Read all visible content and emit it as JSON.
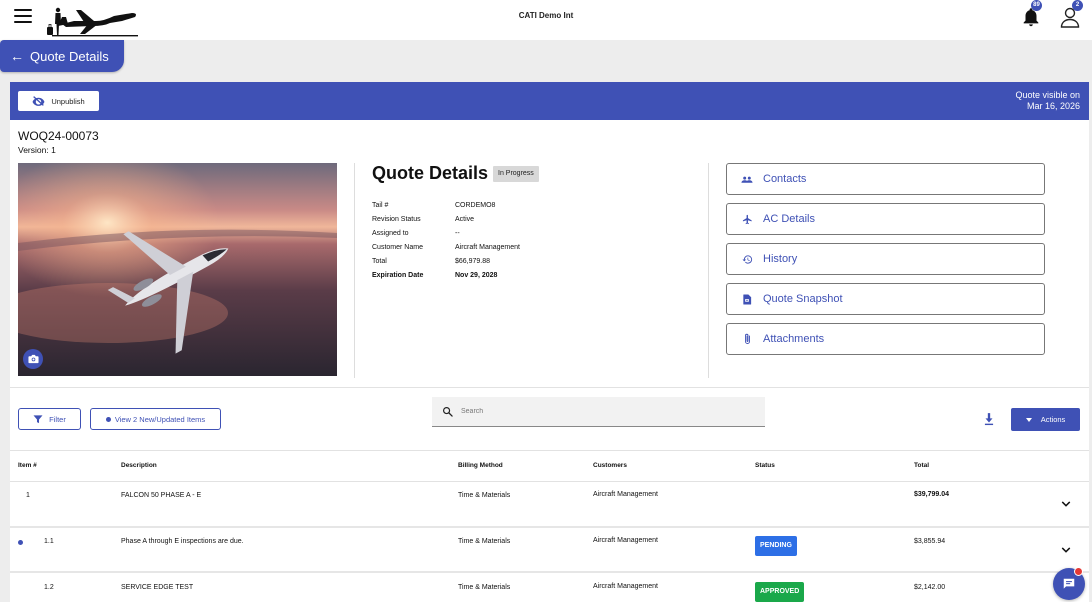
{
  "app": {
    "title": "CATI Demo Int"
  },
  "header": {
    "notifications_count": "89",
    "user_badge": "2"
  },
  "page_tab": {
    "label": "Quote Details"
  },
  "banner": {
    "unpublish_label": "Unpublish",
    "visible_line1": "Quote visible on",
    "visible_line2": "Mar 16, 2026"
  },
  "quote": {
    "number": "WOQ24-00073",
    "version": "Version: 1",
    "title": "Quote Details",
    "status": "In Progress",
    "fields": [
      {
        "key": "Tail #",
        "value": "CORDEMO8"
      },
      {
        "key": "Revision Status",
        "value": "Active"
      },
      {
        "key": "Assigned to",
        "value": "--"
      },
      {
        "key": "Customer Name",
        "value": "Aircraft Management"
      },
      {
        "key": "Total",
        "value": "$66,979.88"
      },
      {
        "key": "Expiration Date",
        "value": "Nov 29, 2028"
      }
    ]
  },
  "side_buttons": [
    {
      "label": "Contacts",
      "icon": "people-icon"
    },
    {
      "label": "AC Details",
      "icon": "airplane-icon"
    },
    {
      "label": "History",
      "icon": "history-icon"
    },
    {
      "label": "Quote Snapshot",
      "icon": "snapshot-icon"
    },
    {
      "label": "Attachments",
      "icon": "paperclip-icon"
    }
  ],
  "toolbar": {
    "filter_label": "Filter",
    "view_updated_label": "View 2 New/Updated Items",
    "search_placeholder": "Search",
    "actions_label": "Actions"
  },
  "table": {
    "headers": [
      "Item #",
      "Description",
      "Billing Method",
      "Customers",
      "Status",
      "Total"
    ],
    "rows": [
      {
        "item": "1",
        "description": "FALCON 50 PHASE A - E",
        "billing": "Time & Materials",
        "customer": "Aircraft Management",
        "status": "",
        "total": "$39,799.04",
        "updated": false
      },
      {
        "item": "1.1",
        "description": "Phase A through E inspections are due.",
        "billing": "Time & Materials",
        "customer": "Aircraft Management",
        "status": "PENDING",
        "total": "$3,855.94",
        "updated": true
      },
      {
        "item": "1.2",
        "description": "SERVICE EDGE TEST",
        "billing": "Time & Materials",
        "customer": "Aircraft Management",
        "status": "APPROVED",
        "total": "$2,142.00",
        "updated": false
      }
    ]
  },
  "colors": {
    "primary": "#3f51b5",
    "pending": "#2d6fe6",
    "approved": "#1aa84a",
    "chat_alert": "#e53935"
  }
}
